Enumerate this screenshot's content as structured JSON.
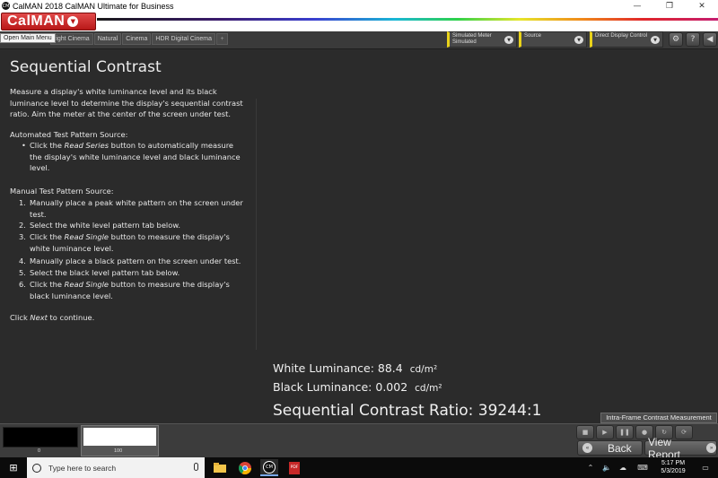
{
  "window": {
    "logo_text": "CM",
    "title": "CalMAN 2018 CalMAN Ultimate for Business",
    "minimize": "—",
    "maximize": "❐",
    "close": "✕"
  },
  "brand": {
    "name": "CalMAN",
    "arrow": "▼"
  },
  "toolbar": {
    "tooltip": "Open Main Menu",
    "workflow_tabs": [
      "right Cinema",
      "Natural",
      "Cinema",
      "HDR Digital Cinema"
    ],
    "add_tab": "+",
    "meter": {
      "line1": "Simulated Meter",
      "line2": "Simulated"
    },
    "source": {
      "line1": "Source"
    },
    "display": {
      "line1": "Direct Display Control"
    },
    "accent": "#e9d21a",
    "icons": [
      "settings-icon",
      "help-icon",
      "back-arrow-icon"
    ],
    "help_glyph": "?"
  },
  "content": {
    "title": "Sequential Contrast",
    "intro": "Measure a display's white luminance level and its black luminance level to determine the display's sequential contrast ratio. Aim the meter at the center of the screen under test.",
    "auto_heading": "Automated Test Pattern Source:",
    "auto_bullet_pre": "Click the ",
    "auto_bullet_em": "Read Series",
    "auto_bullet_post": " button to automatically measure the display's white luminance level and black luminance level.",
    "manual_heading": "Manual Test Pattern Source:",
    "steps": [
      {
        "num": "1.",
        "pre": "Manually place a peak white pattern on the screen under test.",
        "em": "",
        "post": ""
      },
      {
        "num": "2.",
        "pre": "Select the white level pattern tab below.",
        "em": "",
        "post": ""
      },
      {
        "num": "3.",
        "pre": "Click the ",
        "em": "Read Single",
        "post": " button to measure the display's white luminance level."
      },
      {
        "num": "4.",
        "pre": "Manually place a black pattern on the screen under test.",
        "em": "",
        "post": ""
      },
      {
        "num": "5.",
        "pre": "Select the black level pattern tab below.",
        "em": "",
        "post": ""
      },
      {
        "num": "6.",
        "pre": "Click the ",
        "em": "Read Single",
        "post": " button to measure the display's black luminance level."
      }
    ],
    "continue_pre": "Click ",
    "continue_em": "Next",
    "continue_post": " to continue."
  },
  "results": {
    "white_label": "White Luminance: 88.4",
    "white_unit": "cd/m²",
    "black_label": "Black Luminance: 0.002",
    "black_unit": "cd/m²",
    "ratio": "Sequential Contrast Ratio:  39244:1"
  },
  "intra_frame": "Intra-Frame Contrast Measurement",
  "patterns": {
    "black_label": "0",
    "white_label": "100",
    "black_color": "#000000",
    "white_color": "#ffffff"
  },
  "nav": {
    "back": "Back",
    "view_report": "View Report",
    "back_glyph": "«",
    "next_glyph": "»",
    "controls": [
      "stop-icon",
      "play-icon",
      "pause-icon",
      "record-icon",
      "loop-icon",
      "refresh-icon"
    ]
  },
  "taskbar": {
    "search_placeholder": "Type here to search",
    "start_glyph": "⊞",
    "apps": [
      "file-explorer-icon",
      "chrome-icon",
      "calman-icon",
      "pdf-icon"
    ],
    "calman_app_text": "CM",
    "pdf_app_text": "PDF",
    "time": "5:17 PM",
    "date": "5/3/2019"
  }
}
